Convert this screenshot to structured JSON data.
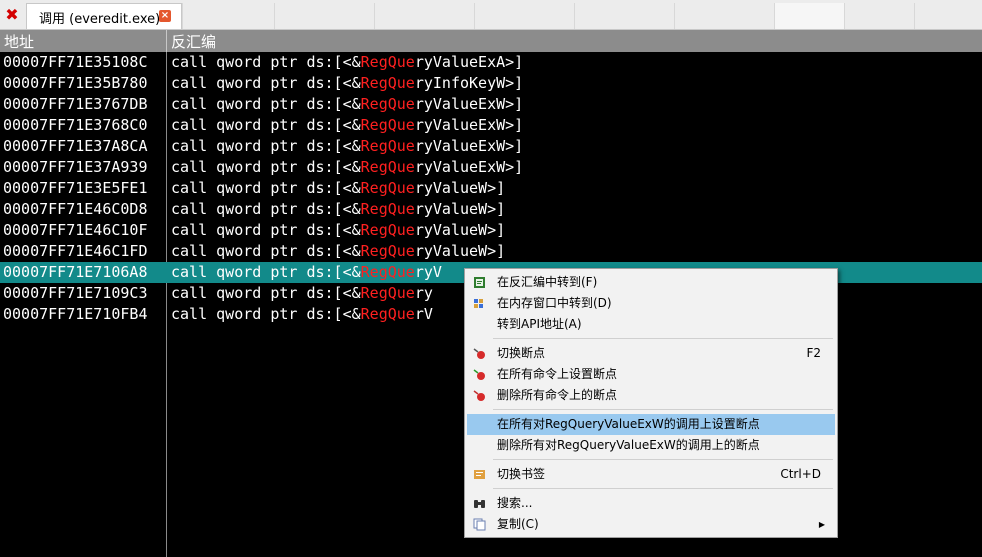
{
  "tab": {
    "title": "调用 (everedit.exe)",
    "close_glyph": "×",
    "x_glyph": "✖"
  },
  "columns": {
    "address": "地址",
    "disassembly": "反汇编"
  },
  "rows": [
    {
      "addr": "00007FF71E35108C",
      "pre": "call qword ptr ds:[<&",
      "fn": "RegQue",
      "post": "ryValueExA>]"
    },
    {
      "addr": "00007FF71E35B780",
      "pre": "call qword ptr ds:[<&",
      "fn": "RegQue",
      "post": "ryInfoKeyW>]"
    },
    {
      "addr": "00007FF71E3767DB",
      "pre": "call qword ptr ds:[<&",
      "fn": "RegQue",
      "post": "ryValueExW>]"
    },
    {
      "addr": "00007FF71E3768C0",
      "pre": "call qword ptr ds:[<&",
      "fn": "RegQue",
      "post": "ryValueExW>]"
    },
    {
      "addr": "00007FF71E37A8CA",
      "pre": "call qword ptr ds:[<&",
      "fn": "RegQue",
      "post": "ryValueExW>]"
    },
    {
      "addr": "00007FF71E37A939",
      "pre": "call qword ptr ds:[<&",
      "fn": "RegQue",
      "post": "ryValueExW>]"
    },
    {
      "addr": "00007FF71E3E5FE1",
      "pre": "call qword ptr ds:[<&",
      "fn": "RegQue",
      "post": "ryValueW>]"
    },
    {
      "addr": "00007FF71E46C0D8",
      "pre": "call qword ptr ds:[<&",
      "fn": "RegQue",
      "post": "ryValueW>]"
    },
    {
      "addr": "00007FF71E46C10F",
      "pre": "call qword ptr ds:[<&",
      "fn": "RegQue",
      "post": "ryValueW>]"
    },
    {
      "addr": "00007FF71E46C1FD",
      "pre": "call qword ptr ds:[<&",
      "fn": "RegQue",
      "post": "ryValueW>]"
    },
    {
      "addr": "00007FF71E7106A8",
      "pre": "call qword ptr ds:[<&",
      "fn": "RegQue",
      "post": "ryV",
      "selected": true
    },
    {
      "addr": "00007FF71E7109C3",
      "pre": "call qword ptr ds:[<&",
      "fn": "RegQue",
      "post": "ry"
    },
    {
      "addr": "00007FF71E710FB4",
      "pre": "call qword ptr ds:[<&",
      "fn": "RegQue",
      "post": "rV"
    }
  ],
  "menu": {
    "items": [
      {
        "label": "在反汇编中转到(F)",
        "icon": "disasm-icon"
      },
      {
        "label": "在内存窗口中转到(D)",
        "icon": "memory-icon"
      },
      {
        "label": "转到API地址(A)",
        "icon": ""
      },
      {
        "label": "切换断点",
        "shortcut": "F2",
        "icon": "breakpoint-toggle-icon"
      },
      {
        "label": "在所有命令上设置断点",
        "icon": "breakpoint-set-icon"
      },
      {
        "label": "删除所有命令上的断点",
        "icon": "breakpoint-remove-icon"
      },
      {
        "label": "在所有对RegQueryValueExW的调用上设置断点",
        "icon": ""
      },
      {
        "label": "删除所有对RegQueryValueExW的调用上的断点",
        "icon": ""
      },
      {
        "label": "切换书签",
        "shortcut": "Ctrl+D",
        "icon": "bookmark-icon"
      },
      {
        "label": "搜索...",
        "icon": "binoculars-icon"
      },
      {
        "label": "复制(C)",
        "icon": "copy-icon",
        "arrow": "▶"
      }
    ]
  },
  "colors": {
    "selected_row": "#128a8a",
    "function_highlight": "#ff2020",
    "menu_hover": "#99c9ef"
  }
}
